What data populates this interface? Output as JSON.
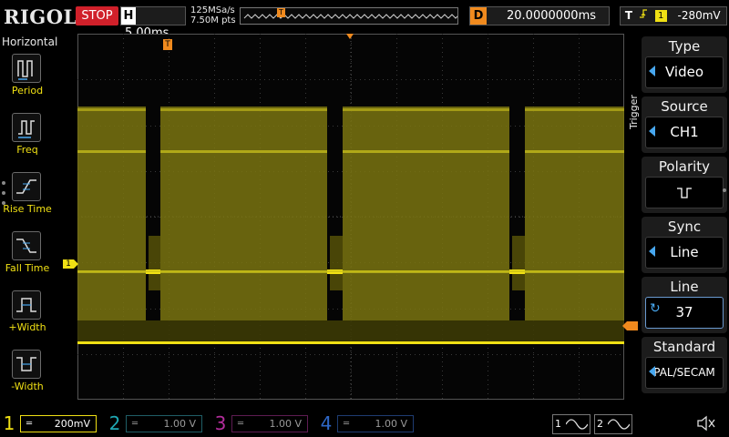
{
  "brand": "RIGOL",
  "status": "STOP",
  "horizontal": {
    "label": "H",
    "timebase": "5.00ms"
  },
  "sample": {
    "rate": "125MSa/s",
    "points": "7.50M pts"
  },
  "delay": {
    "label": "D",
    "value": "20.0000000ms"
  },
  "trigger_status": {
    "label": "T",
    "edge_icon": "rising-edge-icon",
    "channel": "1",
    "level": "-280mV"
  },
  "left_menu": {
    "title": "Horizontal",
    "items": [
      {
        "label": "Period",
        "icon": "period-icon"
      },
      {
        "label": "Freq",
        "icon": "frequency-icon"
      },
      {
        "label": "Rise Time",
        "icon": "rise-time-icon"
      },
      {
        "label": "Fall Time",
        "icon": "fall-time-icon"
      },
      {
        "label": "+Width",
        "icon": "positive-width-icon"
      },
      {
        "label": "-Width",
        "icon": "negative-width-icon"
      }
    ]
  },
  "markers": {
    "trigger_position": "T",
    "channel1": "1"
  },
  "right_menu": {
    "tab": "Trigger",
    "items": [
      {
        "title": "Type",
        "value": "Video"
      },
      {
        "title": "Source",
        "value": "CH1"
      },
      {
        "title": "Polarity",
        "value": "ƖƖ"
      },
      {
        "title": "Sync",
        "value": "Line"
      },
      {
        "title": "Line",
        "value": "37"
      },
      {
        "title": "Standard",
        "value": "PAL/SECAM"
      }
    ]
  },
  "channels": [
    {
      "num": "1",
      "coupling": "═",
      "scale": "200mV",
      "color": "#f0e014",
      "active": true
    },
    {
      "num": "2",
      "coupling": "═",
      "scale": "1.00 V",
      "color": "#1fa8b4",
      "active": false
    },
    {
      "num": "3",
      "coupling": "═",
      "scale": "1.00 V",
      "color": "#b32d9c",
      "active": false
    },
    {
      "num": "4",
      "coupling": "═",
      "scale": "1.00 V",
      "color": "#2e68c8",
      "active": false
    }
  ],
  "generators": [
    {
      "num": "1"
    },
    {
      "num": "2"
    }
  ],
  "colors": {
    "trace": "#f0e014",
    "trigger": "#f08a1e",
    "accent": "#48a8f0"
  }
}
